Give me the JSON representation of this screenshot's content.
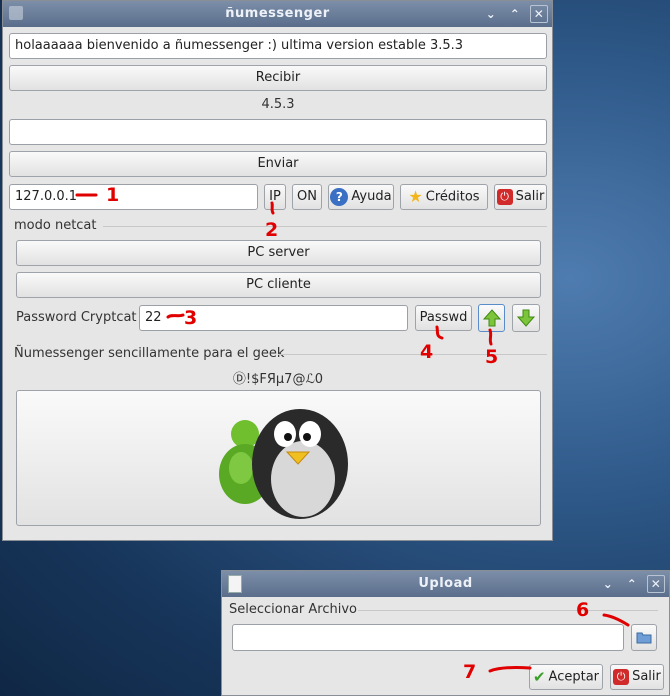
{
  "main_window": {
    "title": "ñumessenger",
    "message_text": "holaaaaaa bienvenido a ñumessenger :) ultima version estable 3.5.3",
    "receive_label": "Recibir",
    "version_label": "4.5.3",
    "send_input_value": "",
    "send_label": "Enviar",
    "ip_value": "127.0.0.1",
    "ip_label": "IP",
    "on_label": "ON",
    "help_label": "Ayuda",
    "credits_label": "Créditos",
    "exit_label": "Salir",
    "netcat_section": "modo netcat",
    "pc_server_label": "PC server",
    "pc_client_label": "PC cliente",
    "password_label": "Password Cryptcat",
    "password_value": "22",
    "passwd_button_label": "Passwd",
    "tagline": "Ñumessenger sencillamente para el geek",
    "signature": "Ⓓ!$FЯµ7@ℒ0"
  },
  "upload_window": {
    "title": "Upload",
    "select_file_label": "Seleccionar Archivo",
    "file_path_value": "",
    "accept_label": "Aceptar",
    "exit_label": "Salir"
  },
  "annotations": [
    "1",
    "2",
    "3",
    "4",
    "5",
    "6",
    "7"
  ],
  "icons": [
    "help-icon",
    "star-icon",
    "power-icon",
    "up-arrow-icon",
    "down-arrow-icon",
    "folder-icon",
    "checkmark-icon",
    "penguin-logo",
    "messenger-logo"
  ],
  "colors": {
    "annotation": "#e00000",
    "titlebar": "#6a7d99",
    "window_bg": "#e6e6e6",
    "arrow_green": "#7cc43a"
  }
}
